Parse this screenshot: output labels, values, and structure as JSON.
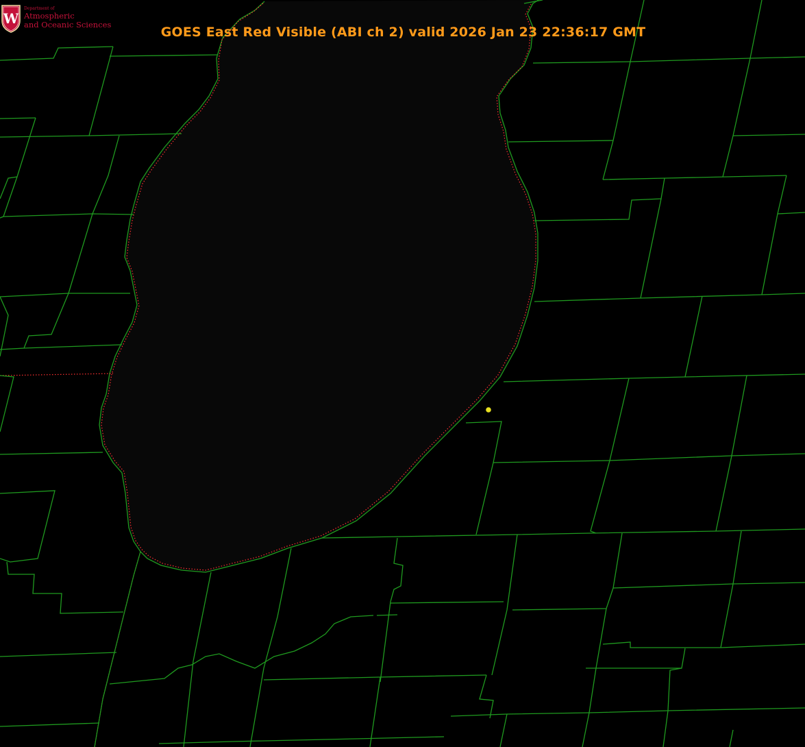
{
  "title": "GOES East Red Visible (ABI ch 2) valid 2026 Jan 23 22:36:17 GMT",
  "logo": {
    "seal_letter": "W",
    "department_label": "Department of",
    "line1": "Atmospheric",
    "line2": "and Oceanic Sciences"
  },
  "colors": {
    "title": "#ff9a1a",
    "county_lines": "#1f9a1f",
    "state_border": "#ff3030",
    "marker": "#e8e020",
    "background": "#000000",
    "logo": "#c4123a"
  },
  "layers": {
    "county_boundaries": true,
    "state_boundary": true,
    "lake_shoreline": true,
    "location_marker": true
  }
}
